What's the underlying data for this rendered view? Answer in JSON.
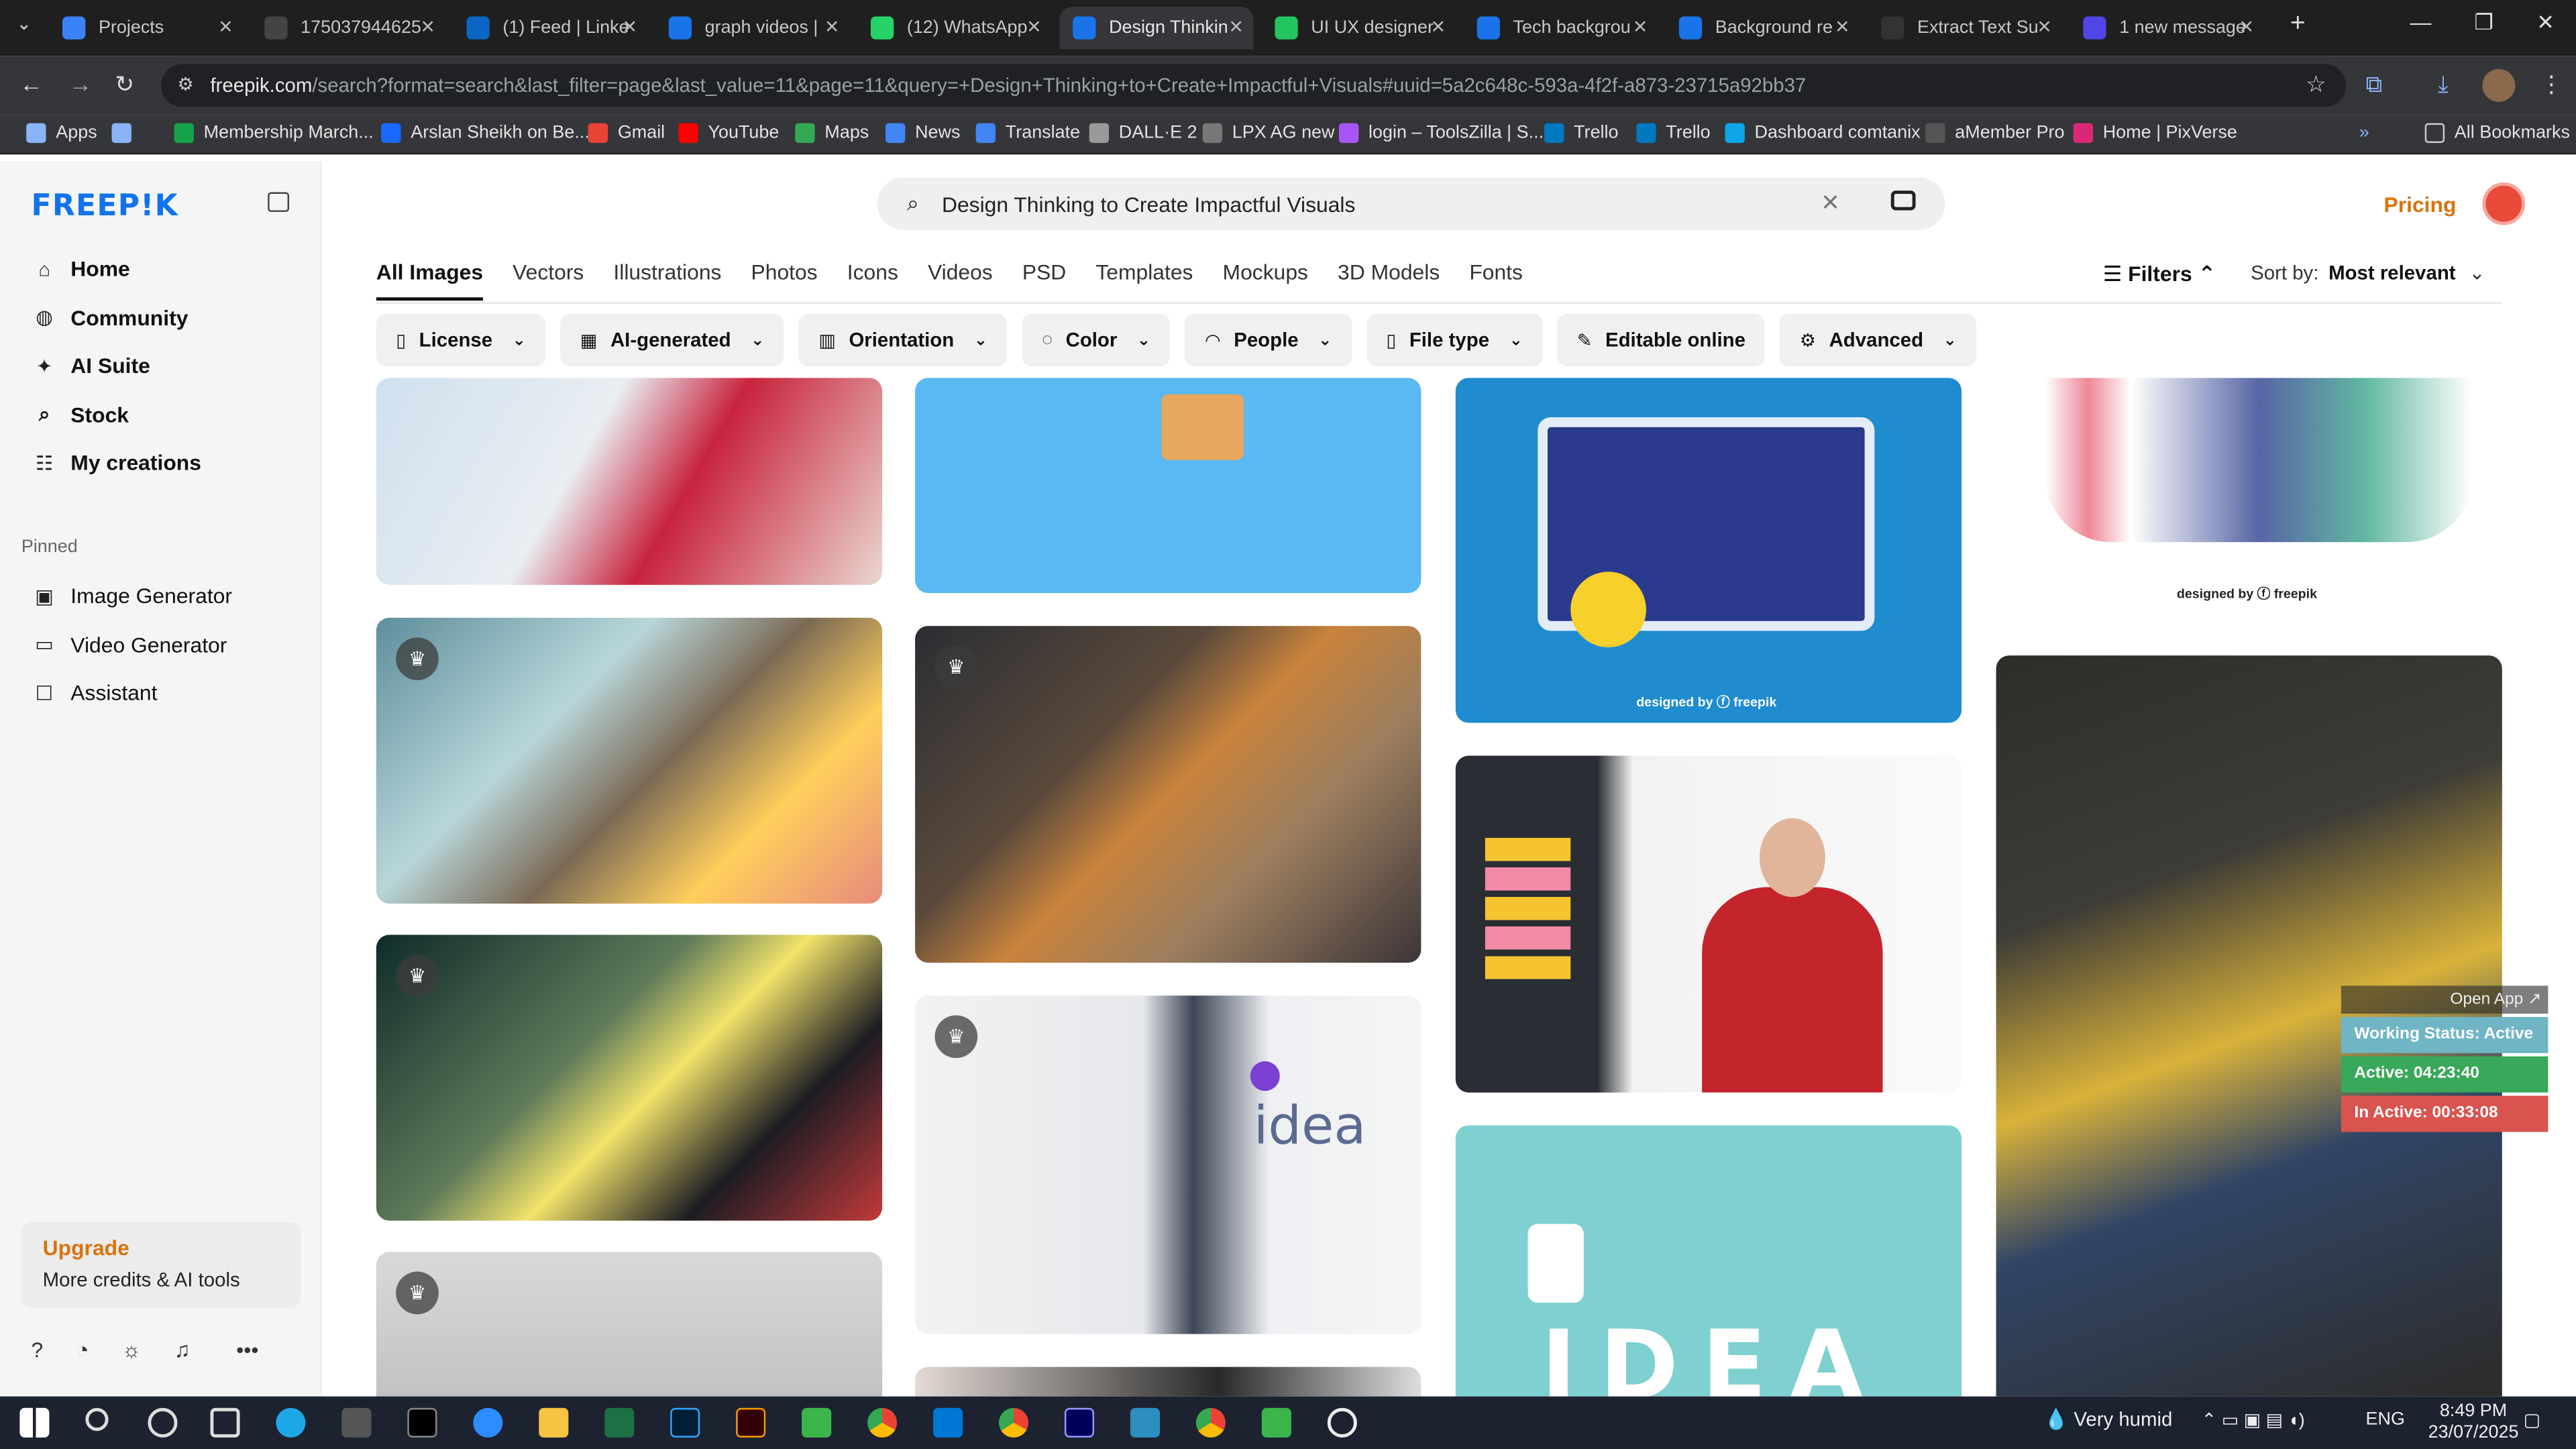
{
  "browser": {
    "tabs": [
      {
        "label": "Projects",
        "color": "#3b82f6"
      },
      {
        "label": "175037944625",
        "color": "#444"
      },
      {
        "label": "(1) Feed | Linke",
        "color": "#0a66c2"
      },
      {
        "label": "graph videos |",
        "color": "#1a73e8"
      },
      {
        "label": "(12) WhatsApp",
        "color": "#25d366"
      },
      {
        "label": "Design Thinkin",
        "color": "#1a73e8"
      },
      {
        "label": "UI UX designer",
        "color": "#22c55e"
      },
      {
        "label": "Tech backgrou",
        "color": "#1a73e8"
      },
      {
        "label": "Background re",
        "color": "#1a73e8"
      },
      {
        "label": "Extract Text Su",
        "color": "#333"
      },
      {
        "label": "1 new message",
        "color": "#4f46e5"
      }
    ],
    "url_host": "freepik.com",
    "url_rest": "/search?format=search&last_filter=page&last_value=11&page=11&query=+Design+Thinking+to+Create+Impactful+Visuals#uuid=5a2c648c-593a-4f2f-a873-23715a92bb37",
    "bookmarks": [
      {
        "label": "Apps",
        "color": "#8ab4f8"
      },
      {
        "label": "",
        "color": "#8ab4f8"
      },
      {
        "label": "Membership March...",
        "color": "#16a34a"
      },
      {
        "label": "Arslan Sheikh on Be...",
        "color": "#1769ff"
      },
      {
        "label": "Gmail",
        "color": "#ea4335"
      },
      {
        "label": "YouTube",
        "color": "#ff0000"
      },
      {
        "label": "Maps",
        "color": "#34a853"
      },
      {
        "label": "News",
        "color": "#4285f4"
      },
      {
        "label": "Translate",
        "color": "#4285f4"
      },
      {
        "label": "DALL·E 2",
        "color": "#999"
      },
      {
        "label": "LPX AG new",
        "color": "#777"
      },
      {
        "label": "login – ToolsZilla | S...",
        "color": "#a855f7"
      },
      {
        "label": "Trello",
        "color": "#0079bf"
      },
      {
        "label": "Trello",
        "color": "#0079bf"
      },
      {
        "label": "Dashboard comtanix",
        "color": "#0ea5e9"
      },
      {
        "label": "aMember Pro",
        "color": "#555"
      },
      {
        "label": "Home | PixVerse",
        "color": "#db2777"
      }
    ],
    "all_bookmarks": "All Bookmarks"
  },
  "sidebar": {
    "logo": "FREEP!K",
    "nav": [
      {
        "label": "Home",
        "icon": "⌂"
      },
      {
        "label": "Community",
        "icon": "◍"
      },
      {
        "label": "AI Suite",
        "icon": "✦"
      },
      {
        "label": "Stock",
        "icon": "⌕"
      },
      {
        "label": "My creations",
        "icon": "☷"
      }
    ],
    "pinned_heading": "Pinned",
    "pinned": [
      {
        "label": "Image Generator",
        "icon": "▣"
      },
      {
        "label": "Video Generator",
        "icon": "▭"
      },
      {
        "label": "Assistant",
        "icon": "☐"
      }
    ],
    "upgrade_title": "Upgrade",
    "upgrade_sub": "More credits & AI tools"
  },
  "search": {
    "query": "Design Thinking to Create Impactful Visuals"
  },
  "header": {
    "pricing": "Pricing"
  },
  "content_tabs": [
    "All Images",
    "Vectors",
    "Illustrations",
    "Photos",
    "Icons",
    "Videos",
    "PSD",
    "Templates",
    "Mockups",
    "3D Models",
    "Fonts"
  ],
  "filters_label": "Filters",
  "sort": {
    "label": "Sort by:",
    "value": "Most relevant"
  },
  "chips": [
    {
      "label": "License",
      "icon": "▯"
    },
    {
      "label": "AI-generated",
      "icon": "▦"
    },
    {
      "label": "Orientation",
      "icon": "▥"
    },
    {
      "label": "Color",
      "icon": "◌"
    },
    {
      "label": "People",
      "icon": "◠"
    },
    {
      "label": "File type",
      "icon": "▯"
    },
    {
      "label": "Editable online",
      "icon": "✎"
    },
    {
      "label": "Advanced",
      "icon": "⚙"
    }
  ],
  "designed_by": "designed by ⓕ freepik",
  "idea_text": "idea",
  "idea_letters": "IDEA",
  "status_widget": {
    "open_app": "Open App ↗",
    "working": "Working Status: Active",
    "active": "Active: 04:23:40",
    "inactive": "In Active: 00:33:08"
  },
  "taskbar": {
    "weather": "Very humid",
    "lang": "ENG",
    "time": "8:49 PM",
    "date": "23/07/2025"
  }
}
